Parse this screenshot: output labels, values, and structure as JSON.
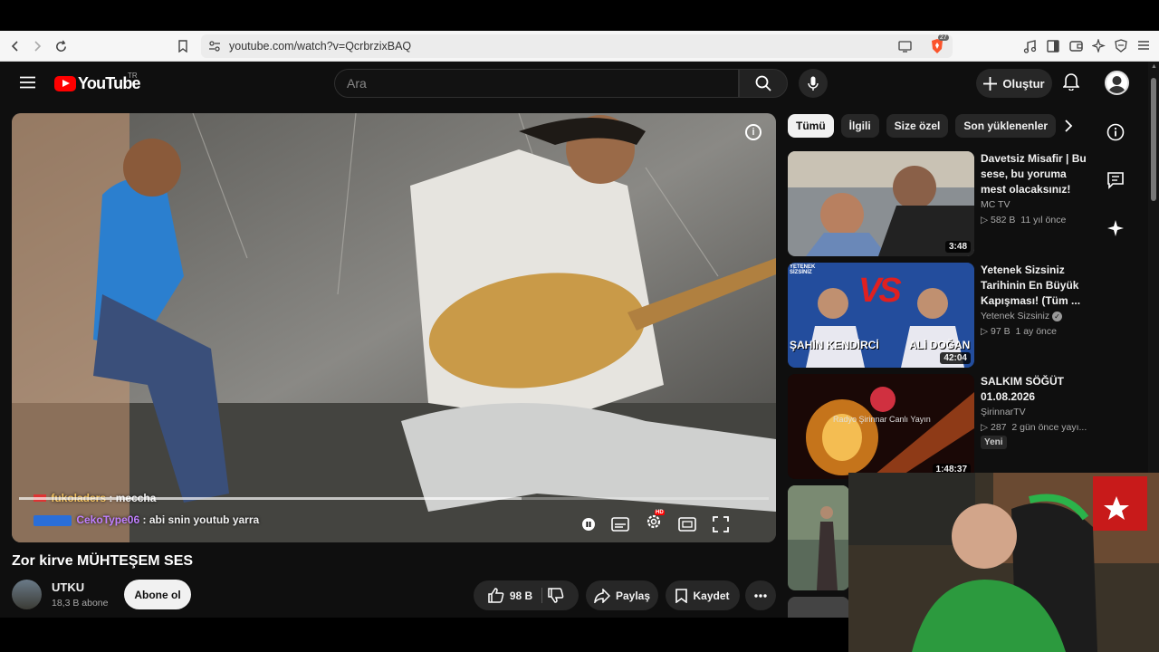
{
  "browser": {
    "url": "youtube.com/watch?v=QcrbrzixBAQ",
    "brave_badge": "27"
  },
  "masthead": {
    "logo_text": "YouTube",
    "country_code": "TR",
    "search_placeholder": "Ara",
    "create_label": "Oluştur"
  },
  "player": {
    "chat": [
      {
        "user": "fukoladers",
        "message": " : meccha",
        "color": "#f0c060"
      },
      {
        "user": "CekoType06",
        "message": " : abi snin youtub yarra",
        "color": "#c080ff"
      }
    ],
    "hd_badge": "HD"
  },
  "video": {
    "title": "Zor kirve MÜHTEŞEM SES",
    "channel_name": "UTKU",
    "channel_subs": "18,3 B abone",
    "subscribe_label": "Abone ol",
    "likes": "98 B",
    "share_label": "Paylaş",
    "save_label": "Kaydet"
  },
  "chips": [
    {
      "label": "Tümü",
      "active": true
    },
    {
      "label": "İlgili",
      "active": false
    },
    {
      "label": "Size özel",
      "active": false
    },
    {
      "label": "Son yüklenenler",
      "active": false
    }
  ],
  "recommendations": [
    {
      "title": "Davetsiz Misafir | Bu sese, bu yoruma mest olacaksınız!",
      "channel": "MC TV",
      "views": "582 B",
      "age": "11 yıl önce",
      "duration": "3:48"
    },
    {
      "title": "Yetenek Sizsiniz Tarihinin En Büyük Kapışması! (Tüm ...",
      "channel": "Yetenek Sizsiniz",
      "views": "97 B",
      "age": "1 ay önce",
      "duration": "42:04",
      "thumb_text_left": "ŞAHİN KENDİRCİ",
      "thumb_text_right": "ALİ DOĞAN",
      "thumb_vs": "VS"
    },
    {
      "title": "SALKIM SÖĞÜT 01.08.2026",
      "channel": "ŞirinnarTV",
      "views": "287",
      "age": "2 gün önce yayı...",
      "duration": "1:48:37",
      "badge": "Yeni",
      "thumb_caption": "Radyo Şirinnar Canlı Yayın"
    }
  ],
  "colors": {
    "brand_red": "#ff0000",
    "background": "#0f0f0f"
  }
}
